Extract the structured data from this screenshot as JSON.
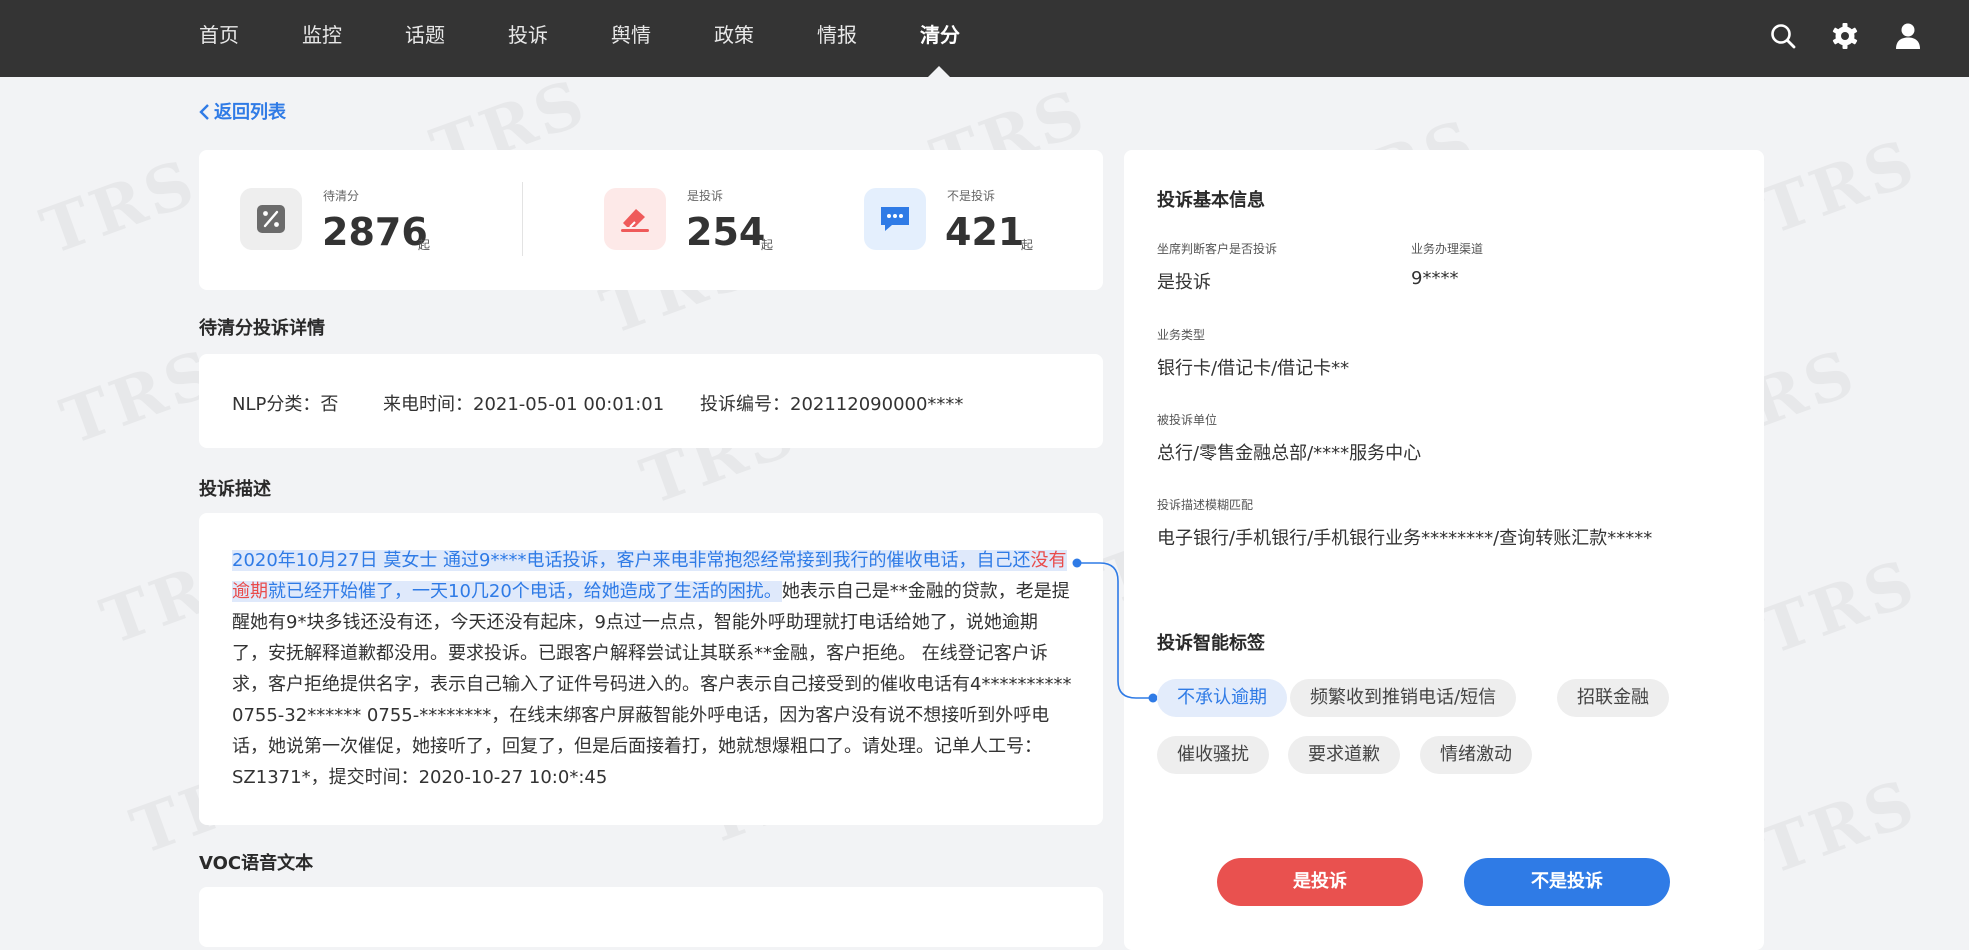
{
  "nav": {
    "items": [
      "首页",
      "监控",
      "话题",
      "投诉",
      "舆情",
      "政策",
      "情报",
      "清分"
    ],
    "active": "清分"
  },
  "icons": {
    "search": "search-icon",
    "settings": "gear-icon",
    "user": "user-icon",
    "back": "chevron-left-icon"
  },
  "back_link": "返回列表",
  "stats": [
    {
      "label": "待清分",
      "value": "2876",
      "unit": "起",
      "icon": "percent-icon",
      "color": "#6b6b6b"
    },
    {
      "label": "是投诉",
      "value": "254",
      "unit": "起",
      "icon": "eraser-icon",
      "color": "#ef5a5a"
    },
    {
      "label": "不是投诉",
      "value": "421",
      "unit": "起",
      "icon": "chat-icon",
      "color": "#2f7be6"
    }
  ],
  "detail": {
    "title": "待清分投诉详情",
    "nlp": "NLP分类：否",
    "call_time": "来电时间：2021-05-01 00:01:01",
    "complaint_no": "投诉编号：202112090000****"
  },
  "description": {
    "title": "投诉描述",
    "highlight_1": "2020年10月27日 莫女士 通过9****电话投诉，客户来电非常抱怨经常接到我行的催收电话，自己还",
    "highlight_red": "没有逾期",
    "highlight_2": "就已经开始催了，一天10几20个电话，给她造成了生活的困扰。",
    "rest": "她表示自己是**金融的贷款，老是提醒她有9*块多钱还没有还，今天还没有起床，9点过一点点，智能外呼助理就打电话给她了，说她逾期了，安抚解释道歉都没用。要求投诉。已跟客户解释尝试让其联系**金融，客户拒绝。 在线登记客户诉求，客户拒绝提供名字，表示自己输入了证件号码进入的。客户表示自己接受到的催收电话有4********** 0755-32****** 0755-********，在线末绑客户屏蔽智能外呼电话，因为客户没有说不想接听到外呼电话，她说第一次催促，她接听了，回复了，但是后面接着打，她就想爆粗口了。请处理。记单人工号：SZ1371*，提交时间：2020-10-27 10:0*:45"
  },
  "voc_title": "VOC语音文本",
  "info": {
    "title": "投诉基本信息",
    "fields": [
      {
        "label": "坐席判断客户是否投诉",
        "value": "是投诉"
      },
      {
        "label": "业务办理渠道",
        "value": "9****"
      },
      {
        "label": "业务类型",
        "value": "银行卡/借记卡/借记卡**"
      },
      {
        "label": "被投诉单位",
        "value": "总行/零售金融总部/****服务中心"
      },
      {
        "label": "投诉描述模糊匹配",
        "value": "电子银行/手机银行/手机银行业务********/查询转账汇款*****"
      }
    ]
  },
  "tags": {
    "title": "投诉智能标签",
    "items": [
      "不承认逾期",
      "频繁收到推销电话/短信",
      "招联金融",
      "催收骚扰",
      "要求道歉",
      "情绪激动"
    ],
    "active": "不承认逾期"
  },
  "actions": {
    "yes_label": "是投诉",
    "no_label": "不是投诉",
    "yes_color": "#e9514f",
    "no_color": "#2f7be6"
  }
}
